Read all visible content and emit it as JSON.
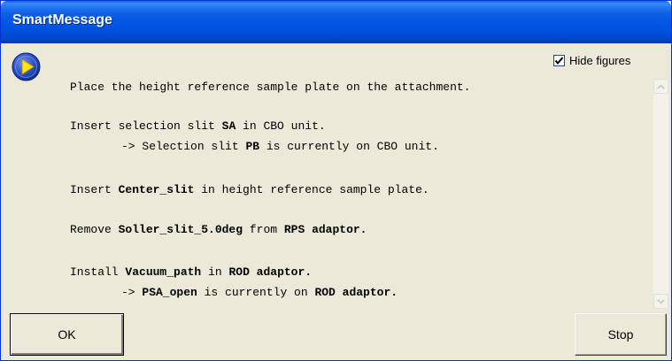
{
  "window": {
    "title": "SmartMessage"
  },
  "options": {
    "hide_figures_label": "Hide figures",
    "hide_figures_checked": true
  },
  "message": {
    "l1": "Place the height reference sample plate on the attachment.",
    "l2_pre": "Insert selection slit ",
    "l2_b": "SA",
    "l2_post": " in CBO unit.",
    "l3_pre": "-> Selection slit ",
    "l3_b": "PB",
    "l3_post": " is currently on CBO unit.",
    "l4_pre": "Insert ",
    "l4_b": "Center_slit",
    "l4_post": " in height reference sample plate.",
    "l5_pre": "Remove ",
    "l5_b1": "Soller_slit_5.0deg",
    "l5_mid": " from ",
    "l5_b2": "RPS adaptor.",
    "l6_pre": "Install ",
    "l6_b1": "Vacuum_path",
    "l6_mid": " in ",
    "l6_b2": "ROD adaptor.",
    "l7_pre": "-> ",
    "l7_b1": "PSA_open",
    "l7_mid": " is currently on ",
    "l7_b2": "ROD adaptor."
  },
  "buttons": {
    "ok_label": "OK",
    "stop_label": "Stop"
  },
  "icons": {
    "message": "play-arrow-icon",
    "scroll_up": "scroll-up-arrow-icon",
    "scroll_down": "scroll-down-arrow-icon",
    "checkmark": "checkmark-icon"
  },
  "colors": {
    "titlebar": "#0055e5",
    "dialog_bg": "#ece9d8",
    "icon_blue": "#1b44b8",
    "icon_yellow": "#ffe41a"
  }
}
